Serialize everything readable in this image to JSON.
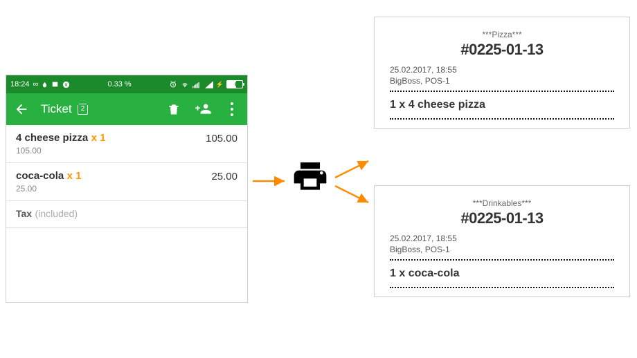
{
  "phone": {
    "status": {
      "time": "18:24",
      "battery_pct_top": "0.33 %",
      "battery_label": "60"
    },
    "toolbar": {
      "title": "Ticket",
      "badge": "2"
    },
    "items": [
      {
        "name": "4 cheese pizza",
        "qty": "x 1",
        "price": "105.00",
        "sub": "105.00"
      },
      {
        "name": "coca-cola",
        "qty": "x 1",
        "price": "25.00",
        "sub": "25.00"
      }
    ],
    "tax": {
      "label": "Tax",
      "hint": "(included)"
    }
  },
  "receipts": [
    {
      "station": "***Pizza***",
      "order_no": "#0225-01-13",
      "datetime": "25.02.2017, 18:55",
      "pos": "BigBoss, POS-1",
      "line": "1 x 4 cheese pizza"
    },
    {
      "station": "***Drinkables***",
      "order_no": "#0225-01-13",
      "datetime": "25.02.2017, 18:55",
      "pos": "BigBoss, POS-1",
      "line": "1 x coca-cola"
    }
  ]
}
